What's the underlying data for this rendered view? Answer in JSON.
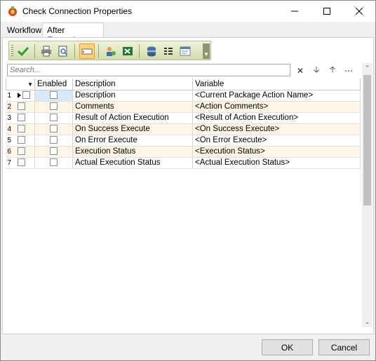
{
  "window": {
    "title": "Check Connection Properties"
  },
  "tabs": [
    {
      "label": "Workflow"
    },
    {
      "label": "After Execution"
    }
  ],
  "toolbar": {
    "buttons": [
      "check-icon",
      "print-icon",
      "print-preview-icon",
      "textbox-icon",
      "user-connection-icon",
      "excel-icon",
      "database-icon",
      "columns-icon",
      "form-icon"
    ]
  },
  "search": {
    "placeholder": "Search..."
  },
  "grid": {
    "columns": [
      "",
      "Enabled",
      "Description",
      "Variable"
    ],
    "rows": [
      {
        "num": "1",
        "description": "Description",
        "variable": "<Current Package Action Name>"
      },
      {
        "num": "2",
        "description": "Comments",
        "variable": "<Action Comments>"
      },
      {
        "num": "3",
        "description": "Result of Action Execution",
        "variable": "<Result of Action Execution>"
      },
      {
        "num": "4",
        "description": "On Success Execute",
        "variable": "<On Success Execute>"
      },
      {
        "num": "5",
        "description": "On Error Execute",
        "variable": "<On Error Execute>"
      },
      {
        "num": "6",
        "description": "Execution Status",
        "variable": "<Execution Status>"
      },
      {
        "num": "7",
        "description": "Actual Execution Status",
        "variable": "<Actual Execution Status>"
      }
    ]
  },
  "footer": {
    "ok_label": "OK",
    "cancel_label": "Cancel"
  }
}
